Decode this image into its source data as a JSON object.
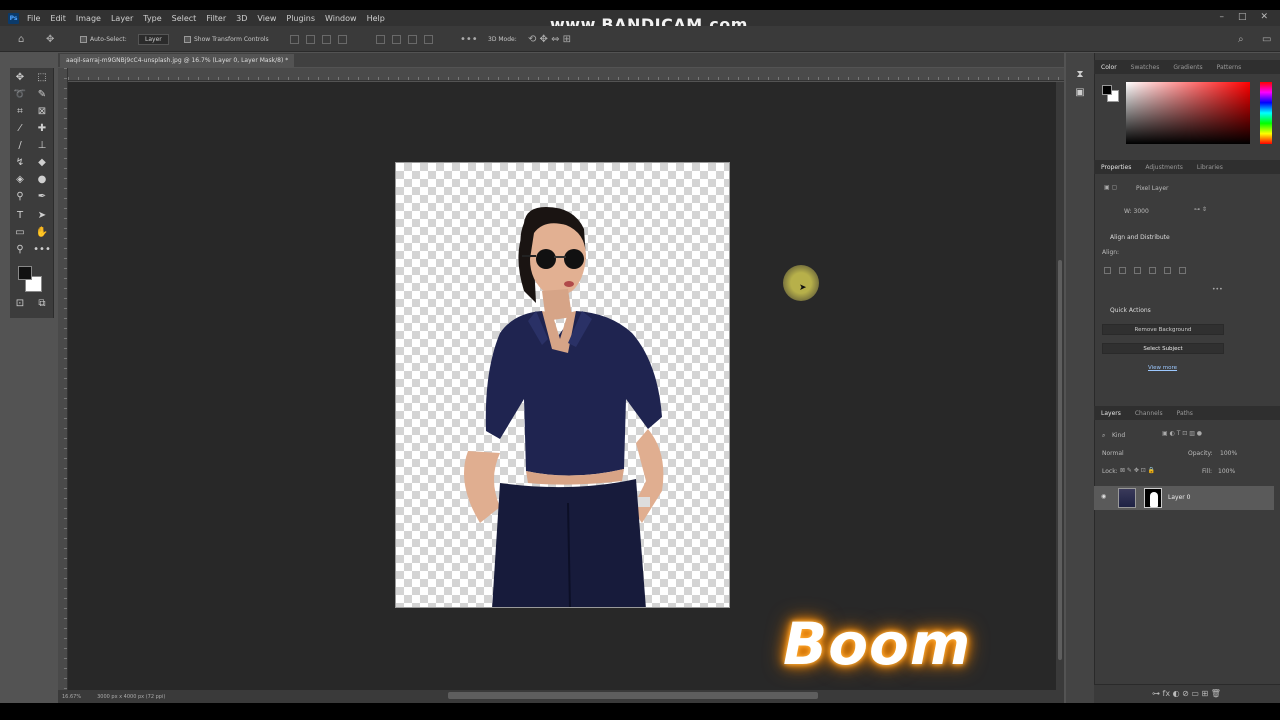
{
  "watermark": "www.BANDICAM.com",
  "menu": {
    "app_badge": "Ps",
    "items": [
      "File",
      "Edit",
      "Image",
      "Layer",
      "Type",
      "Select",
      "Filter",
      "3D",
      "View",
      "Plugins",
      "Window",
      "Help"
    ]
  },
  "options_bar": {
    "auto_select_label": "Auto-Select:",
    "auto_select_value": "Layer",
    "show_transform_label": "Show Transform Controls",
    "mode_label": "3D Mode:"
  },
  "document_tab": {
    "title": "aaqil-sarraj-m9GNBj9cC4-unsplash.jpg @ 16.7% (Layer 0, Layer Mask/8) *"
  },
  "status_bar": {
    "zoom": "16.67%",
    "doc_info": "3000 px x 4000 px (72 ppi)"
  },
  "canvas": {
    "boom_text": "Boom"
  },
  "panels": {
    "color_tabs": [
      "Color",
      "Swatches",
      "Gradients",
      "Patterns"
    ],
    "properties_tabs": [
      "Properties",
      "Adjustments",
      "Libraries"
    ],
    "layer_type": "Pixel Layer",
    "w_value": "W: 3000",
    "align_heading": "Align and Distribute",
    "align_label": "Align:",
    "quick_actions_heading": "Quick Actions",
    "remove_bg_button": "Remove Background",
    "select_subject_button": "Select Subject",
    "view_more_link": "View more",
    "layers_tabs": [
      "Layers",
      "Channels",
      "Paths"
    ],
    "filter_kind": "Kind",
    "blend_mode": "Normal",
    "opacity_label": "Opacity:",
    "opacity_value": "100%",
    "lock_label": "Lock:",
    "fill_label": "Fill:",
    "fill_value": "100%",
    "layer_name": "Layer 0"
  },
  "colors": {
    "app_bg": "#535353",
    "canvas_bg": "#282828",
    "panel_bg": "#3c3c3c",
    "boom_glow": "#ff9a1c"
  }
}
